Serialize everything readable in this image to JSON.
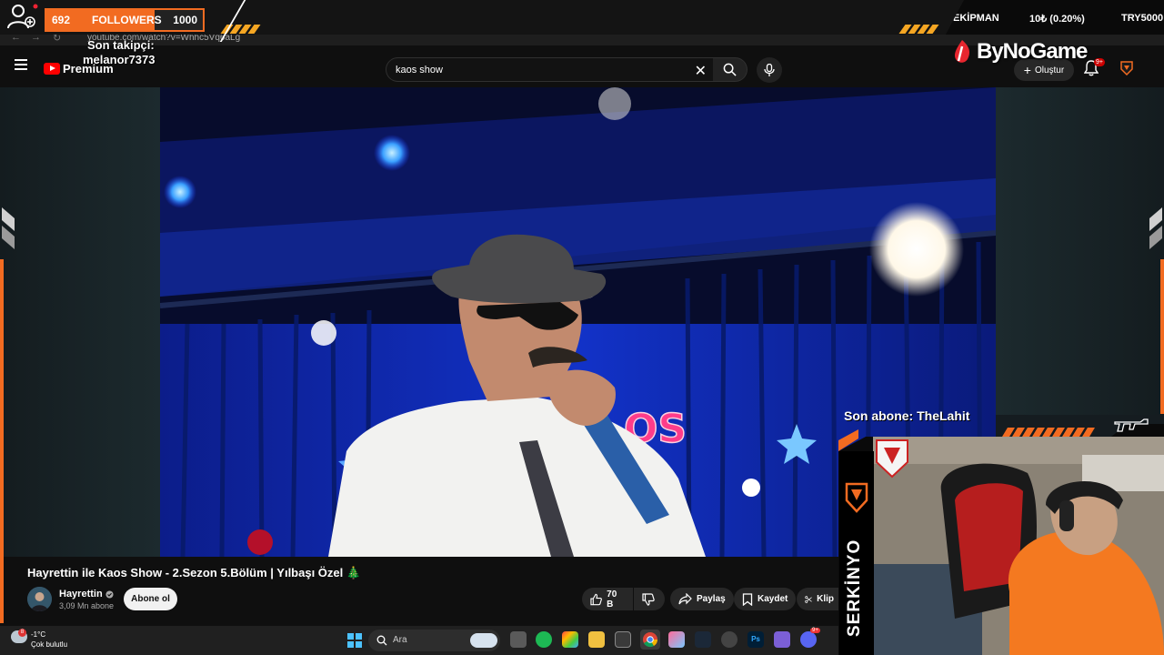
{
  "overlay": {
    "followers_count": "692",
    "followers_label": "FOLLOWERS",
    "followers_goal": "1000",
    "followers_progress": 0.692,
    "son_takipci_label": "Son takipçi:",
    "son_takipci_name": "melanor7373",
    "ekipman_label": "EKİPMAN",
    "ekipman_value": "10₺ (0.20%)",
    "ekipman_currency": "TRY5000",
    "brand": "ByNoGame",
    "son_abone": "Son abone: TheLahit",
    "streamer_name": "SERKİNYO",
    "accent_color": "#f26b21"
  },
  "browser": {
    "url": "youtube.com/watch?v=Whhc5Vq6aLg"
  },
  "youtube": {
    "logo_text": "Premium",
    "search_value": "kaos show",
    "create_label": "Oluştur",
    "notif_badge": "9+"
  },
  "video": {
    "title": "Hayrettin ile Kaos Show - 2.Sezon 5.Bölüm | Yılbaşı Özel 🎄",
    "channel": "Hayrettin",
    "subscribers": "3,09 Mn abone",
    "subscribe_label": "Abone ol",
    "likes": "70 B",
    "share_label": "Paylaş",
    "save_label": "Kaydet",
    "clip_label": "Klip",
    "sign_text": "OS"
  },
  "taskbar": {
    "temperature": "-1°C",
    "condition": "Çok bulutlu",
    "weather_badge": "8",
    "search_placeholder": "Ara",
    "discord_badge": "9+"
  }
}
